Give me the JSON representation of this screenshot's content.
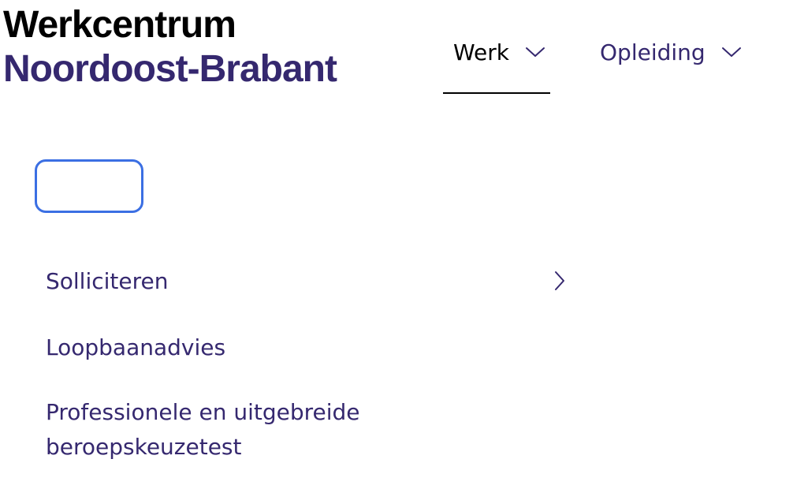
{
  "logo": {
    "line1": "Werkcentrum",
    "line2": "Noordoost-Brabant"
  },
  "nav": {
    "items": [
      {
        "label": "Werk",
        "icon": "chevron-down-icon",
        "active": true
      },
      {
        "label": "Opleiding",
        "icon": "chevron-down-icon",
        "active": false
      }
    ]
  },
  "menu": {
    "items": [
      {
        "label": "Solliciteren",
        "icon": "chevron-right-icon"
      },
      {
        "label": "Loopbaanadvies"
      },
      {
        "label": "Professionele en uitgebreide beroepskeuzetest"
      }
    ]
  },
  "colors": {
    "brand_purple": "#35286f",
    "focus_blue": "#3b6fe3",
    "text_black": "#000000"
  }
}
